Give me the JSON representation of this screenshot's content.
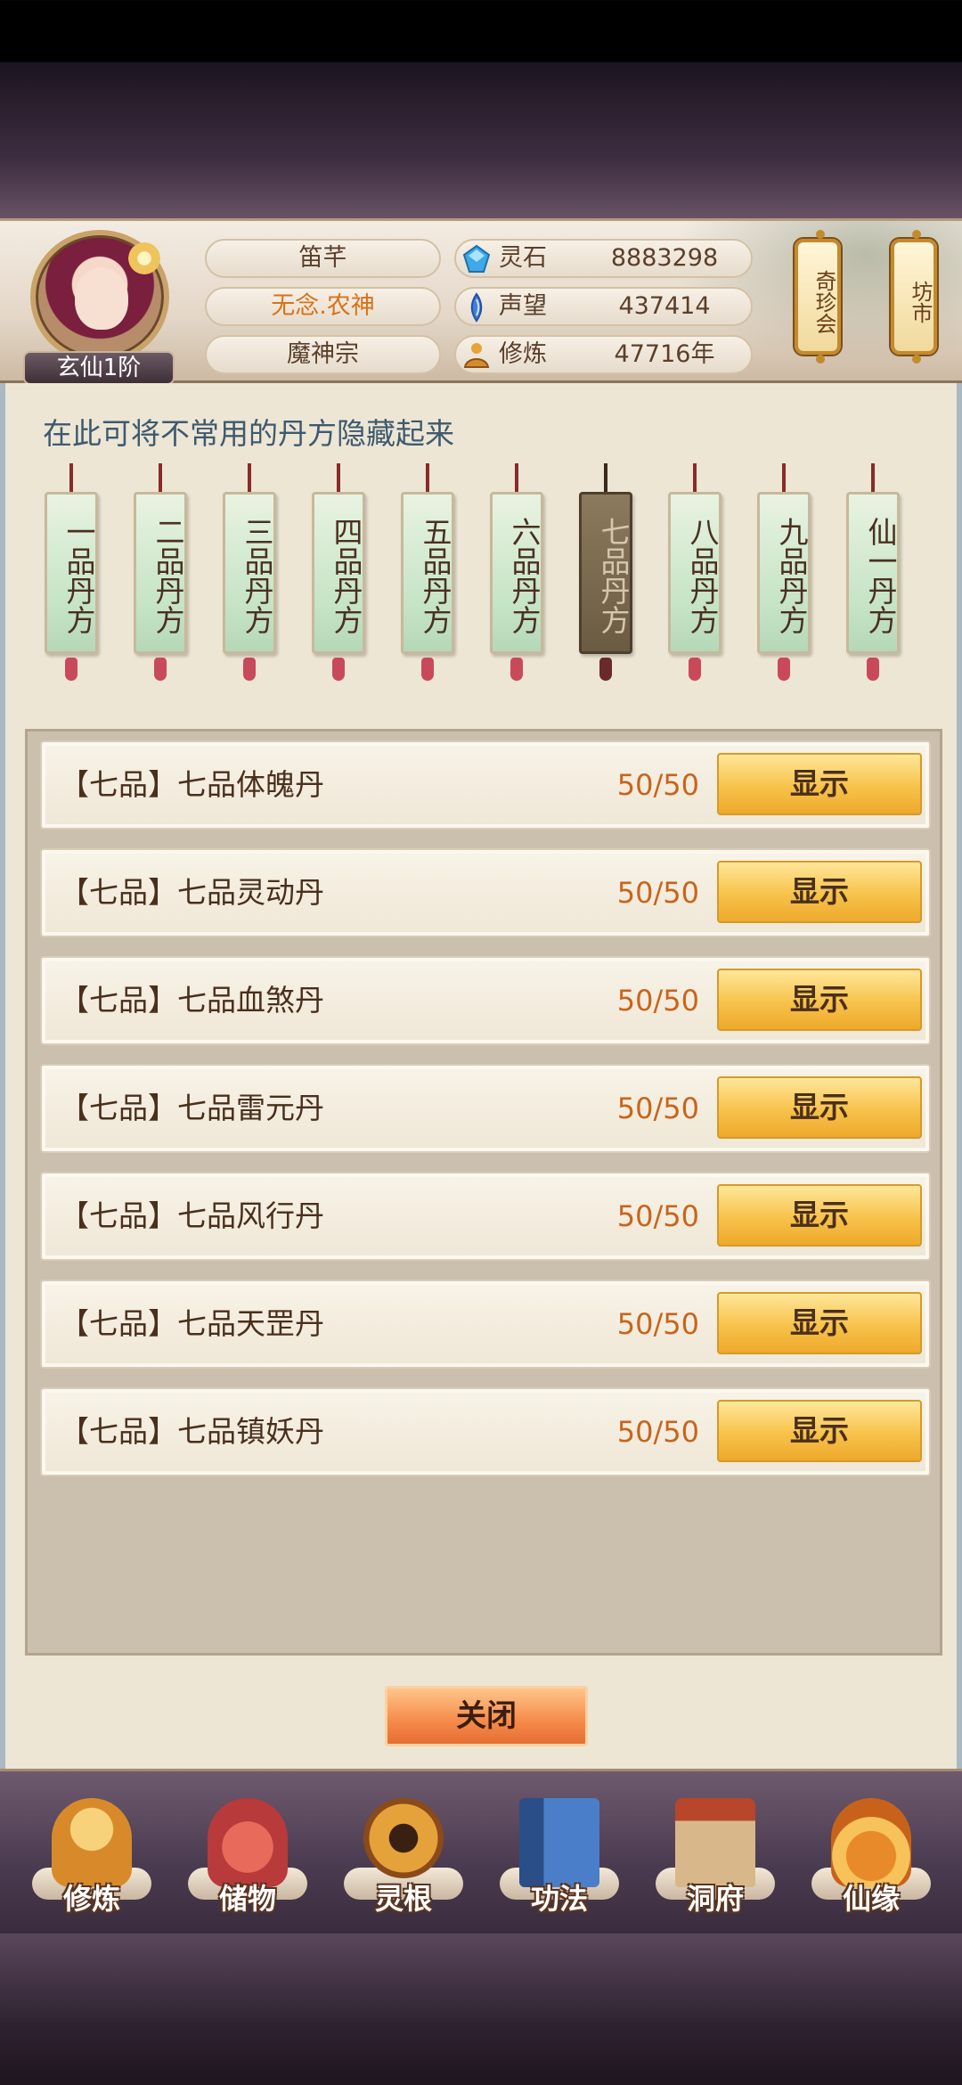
{
  "header": {
    "rank": "玄仙1阶",
    "player_name": "笛芊",
    "title": "无念.农神",
    "sect": "魔神宗",
    "resources": [
      {
        "icon": "spirit-stone-icon",
        "label": "灵石",
        "value": "8883298"
      },
      {
        "icon": "reputation-icon",
        "label": "声望",
        "value": "437414"
      },
      {
        "icon": "cultivation-icon",
        "label": "修炼",
        "value": "47716年"
      }
    ],
    "lanterns": [
      {
        "label": "奇珍会"
      },
      {
        "label": "坊市"
      }
    ]
  },
  "panel": {
    "hint": "在此可将不常用的丹方隐藏起来",
    "tabs": [
      {
        "label": "一品丹方",
        "active": false
      },
      {
        "label": "二品丹方",
        "active": false
      },
      {
        "label": "三品丹方",
        "active": false
      },
      {
        "label": "四品丹方",
        "active": false
      },
      {
        "label": "五品丹方",
        "active": false
      },
      {
        "label": "六品丹方",
        "active": false
      },
      {
        "label": "七品丹方",
        "active": true
      },
      {
        "label": "八品丹方",
        "active": false
      },
      {
        "label": "九品丹方",
        "active": false
      },
      {
        "label": "仙一丹方",
        "active": false
      }
    ],
    "rows": [
      {
        "name": "【七品】七品体魄丹",
        "count": "50/50",
        "button": "显示"
      },
      {
        "name": "【七品】七品灵动丹",
        "count": "50/50",
        "button": "显示"
      },
      {
        "name": "【七品】七品血煞丹",
        "count": "50/50",
        "button": "显示"
      },
      {
        "name": "【七品】七品雷元丹",
        "count": "50/50",
        "button": "显示"
      },
      {
        "name": "【七品】七品风行丹",
        "count": "50/50",
        "button": "显示"
      },
      {
        "name": "【七品】七品天罡丹",
        "count": "50/50",
        "button": "显示"
      },
      {
        "name": "【七品】七品镇妖丹",
        "count": "50/50",
        "button": "显示"
      }
    ],
    "close_label": "关闭"
  },
  "nav": {
    "items": [
      {
        "icon": "cultivate-icon",
        "label": "修炼",
        "color": "#e0a23a"
      },
      {
        "icon": "storage-bag-icon",
        "label": "储物",
        "color": "#c8453e"
      },
      {
        "icon": "spirit-root-icon",
        "label": "灵根",
        "color": "#b8682a"
      },
      {
        "icon": "technique-book-icon",
        "label": "功法",
        "color": "#3e6ea8"
      },
      {
        "icon": "cave-mansion-icon",
        "label": "洞府",
        "color": "#8a5a3a"
      },
      {
        "icon": "immortal-gourd-icon",
        "label": "仙缘",
        "color": "#d8822a"
      }
    ]
  }
}
